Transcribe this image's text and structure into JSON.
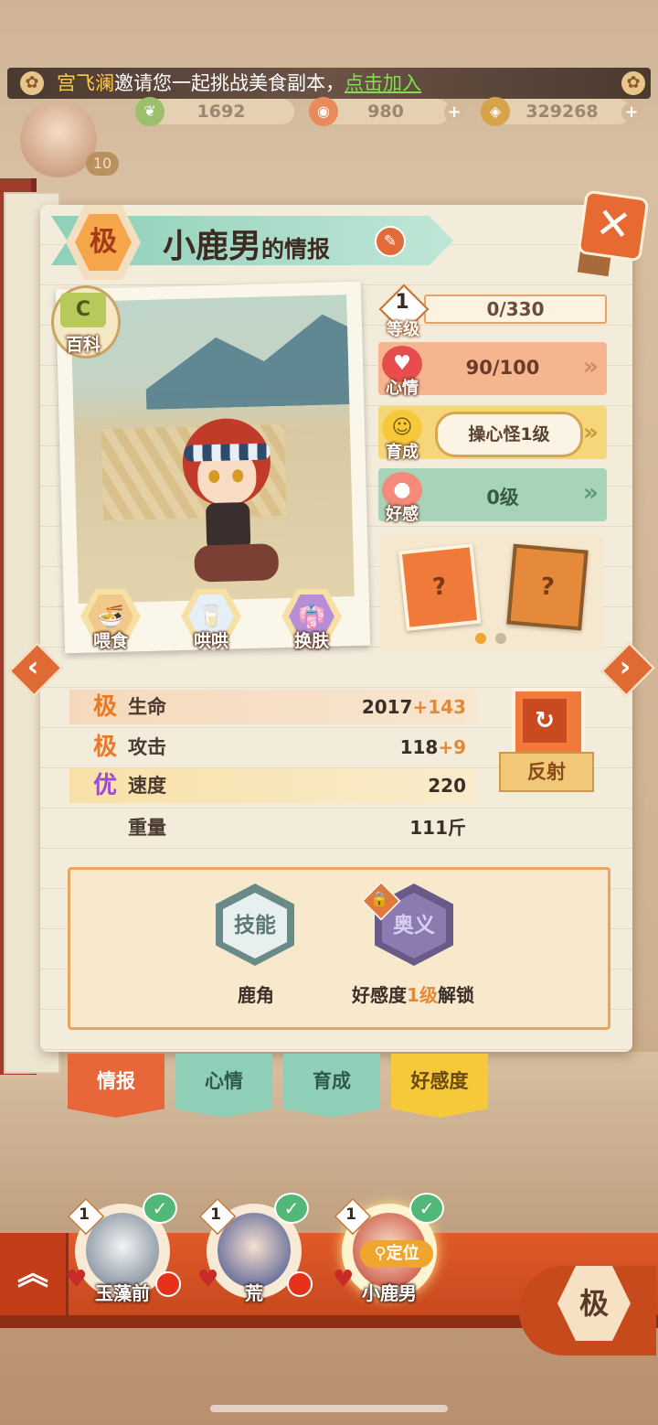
{
  "notice": {
    "name": "宫飞澜",
    "text": "邀请您一起挑战美食副本，",
    "link": "点击加入"
  },
  "resources": [
    {
      "icon": "leaf-currency-icon",
      "value": "1692"
    },
    {
      "icon": "fish-currency-icon",
      "value": "980"
    },
    {
      "icon": "coin-currency-icon",
      "value": "329268"
    }
  ],
  "player_level": "10",
  "panel": {
    "grade": "极",
    "name": "小鹿男",
    "title_suffix": "的情报",
    "baike": "百科",
    "actions": [
      {
        "label": "喂食",
        "icon": "ramen-icon"
      },
      {
        "label": "哄哄",
        "icon": "milk-icon"
      },
      {
        "label": "换肤",
        "icon": "kimono-icon"
      }
    ],
    "level": {
      "value": "1",
      "label": "等级",
      "exp": "0/330"
    },
    "mood": {
      "label": "心情",
      "value": "90/100"
    },
    "training": {
      "label": "育成",
      "value": "操心怪1级"
    },
    "affection": {
      "label": "好感",
      "value": "0级"
    },
    "attributes": [
      {
        "grade": "极",
        "name": "生命",
        "base": "2017",
        "bonus": "+143"
      },
      {
        "grade": "极",
        "name": "攻击",
        "base": "118",
        "bonus": "+9"
      },
      {
        "grade": "优",
        "name": "速度",
        "base": "220",
        "bonus": ""
      },
      {
        "grade": "",
        "name": "重量",
        "base": "111斤",
        "bonus": ""
      }
    ],
    "reflect_label": "反射",
    "skill": {
      "hex": "技能",
      "label": "鹿角"
    },
    "ultimate": {
      "hex": "奥义",
      "label_pre": "好感度",
      "label_lvl": "1级",
      "label_post": "解锁"
    }
  },
  "tabs": [
    "情报",
    "心情",
    "育成",
    "好感度"
  ],
  "team": [
    {
      "name": "玉藻前",
      "level": "1"
    },
    {
      "name": "荒",
      "level": "1"
    },
    {
      "name": "小鹿男",
      "level": "1"
    }
  ],
  "locate_label": "定位",
  "grade_button": "极",
  "colors": {
    "accent": "#e06a33",
    "mood": "#f5b58f",
    "affection": "#a7d4b8",
    "training": "#f6d67a",
    "skill_border": "#e9a462"
  }
}
